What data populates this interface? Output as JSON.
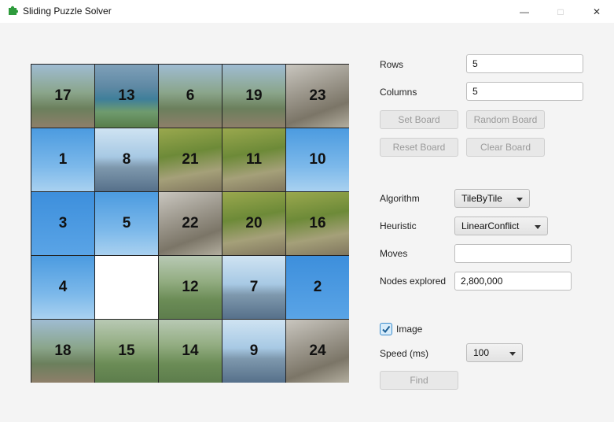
{
  "window": {
    "title": "Sliding Puzzle Solver",
    "min_glyph": "—",
    "max_glyph": "□",
    "close_glyph": "✕"
  },
  "board": {
    "tiles": [
      {
        "n": "17",
        "bg": "t-fence"
      },
      {
        "n": "13",
        "bg": "t-lake"
      },
      {
        "n": "6",
        "bg": "t-fence"
      },
      {
        "n": "19",
        "bg": "t-fence"
      },
      {
        "n": "23",
        "bg": "t-rock"
      },
      {
        "n": "1",
        "bg": "t-sky"
      },
      {
        "n": "8",
        "bg": "t-mount"
      },
      {
        "n": "21",
        "bg": "t-green"
      },
      {
        "n": "11",
        "bg": "t-green"
      },
      {
        "n": "10",
        "bg": "t-sky"
      },
      {
        "n": "3",
        "bg": "t-skyclear"
      },
      {
        "n": "5",
        "bg": "t-sky"
      },
      {
        "n": "22",
        "bg": "t-rock"
      },
      {
        "n": "20",
        "bg": "t-green"
      },
      {
        "n": "16",
        "bg": "t-green"
      },
      {
        "n": "4",
        "bg": "t-sky"
      },
      {
        "n": "",
        "bg": "empty"
      },
      {
        "n": "12",
        "bg": "t-valley"
      },
      {
        "n": "7",
        "bg": "t-mount"
      },
      {
        "n": "2",
        "bg": "t-skyclear"
      },
      {
        "n": "18",
        "bg": "t-fence"
      },
      {
        "n": "15",
        "bg": "t-valley"
      },
      {
        "n": "14",
        "bg": "t-valley"
      },
      {
        "n": "9",
        "bg": "t-mount"
      },
      {
        "n": "24",
        "bg": "t-rock"
      }
    ]
  },
  "controls": {
    "rows_label": "Rows",
    "rows_value": "5",
    "columns_label": "Columns",
    "columns_value": "5",
    "set_board": "Set Board",
    "random_board": "Random Board",
    "reset_board": "Reset Board",
    "clear_board": "Clear Board",
    "algorithm_label": "Algorithm",
    "algorithm_value": "TileByTile",
    "heuristic_label": "Heuristic",
    "heuristic_value": "LinearConflict",
    "moves_label": "Moves",
    "moves_value": "",
    "nodes_label": "Nodes explored",
    "nodes_value": "2,800,000",
    "image_label": "Image",
    "image_checked": true,
    "speed_label": "Speed (ms)",
    "speed_value": "100",
    "find": "Find"
  }
}
